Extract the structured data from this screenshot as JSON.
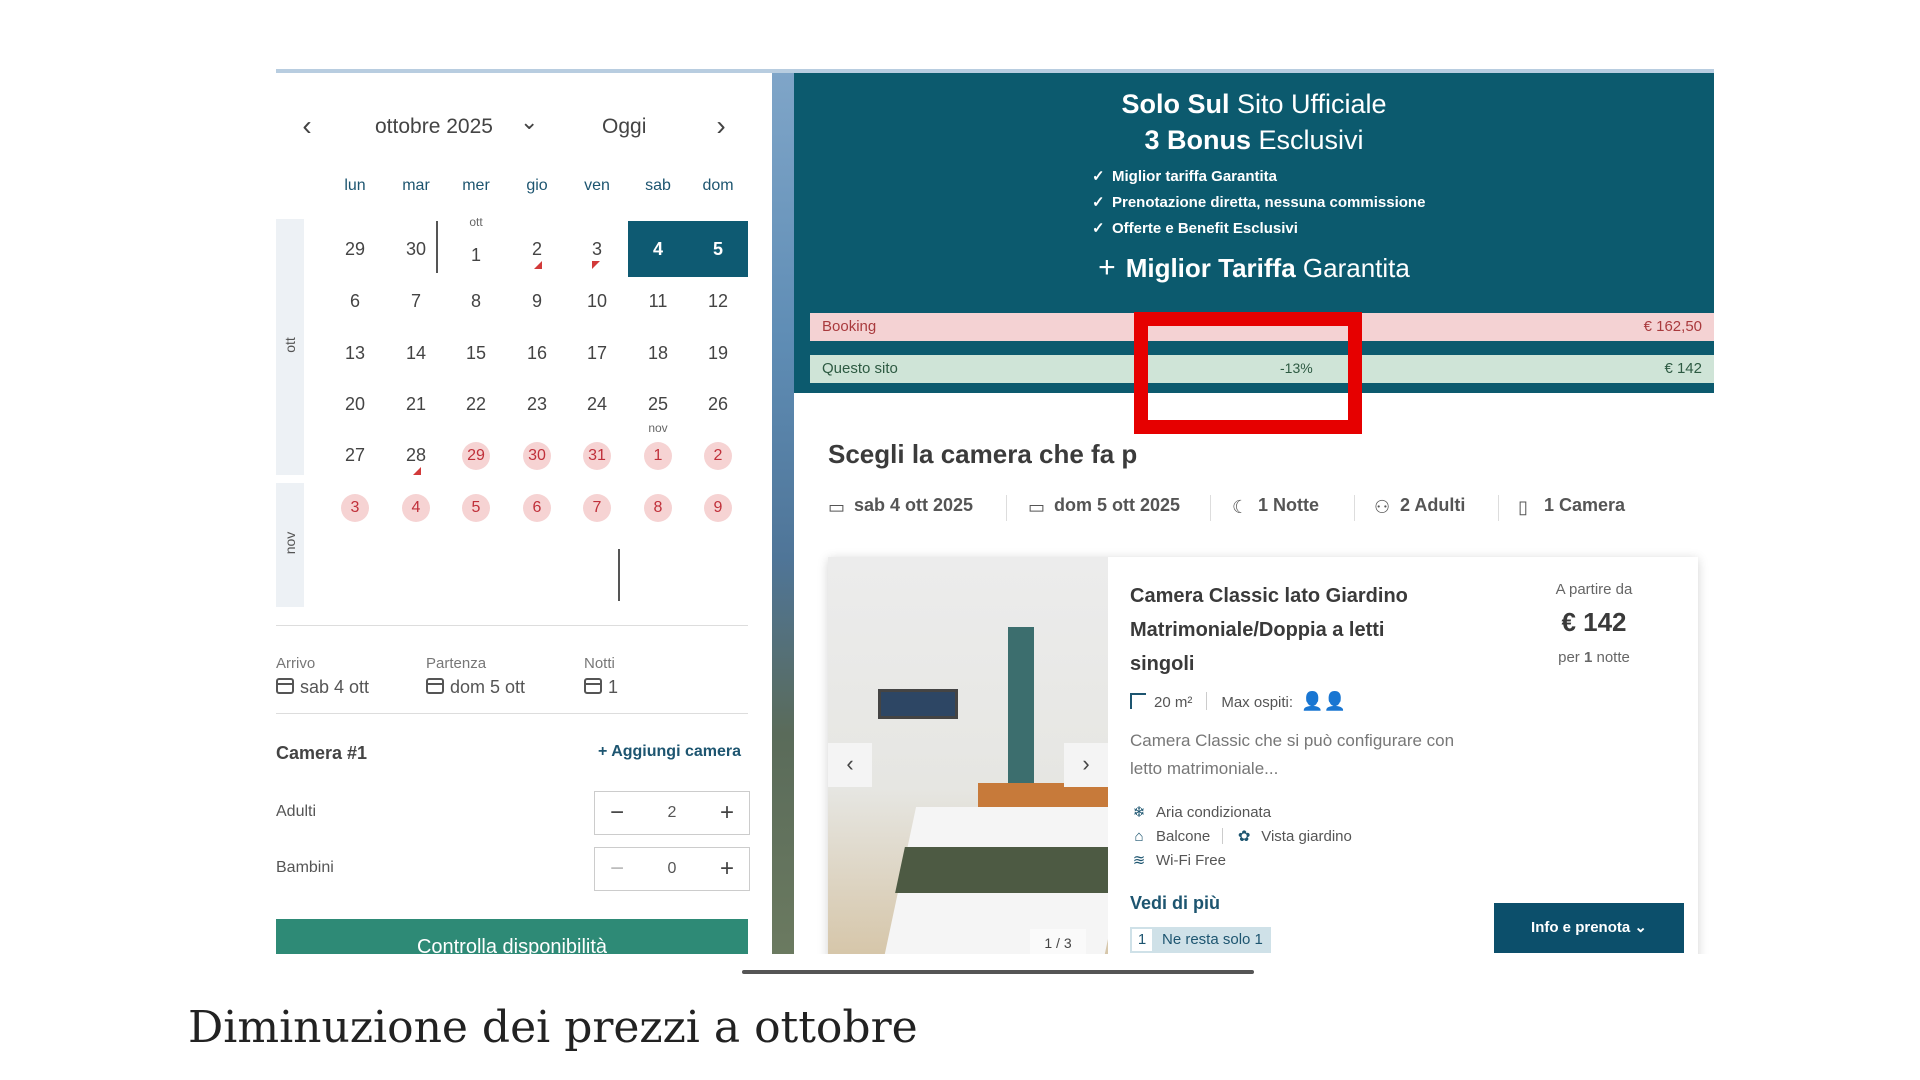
{
  "calendar": {
    "month_title": "ottobre 2025",
    "today": "Oggi",
    "weekdays": [
      "lun",
      "mar",
      "mer",
      "gio",
      "ven",
      "sab",
      "dom"
    ],
    "side_oct": "ott",
    "side_nov": "nov",
    "oct_label": "ott",
    "nov_label": "nov",
    "rows": [
      [
        "29",
        "30",
        "1",
        "2",
        "3",
        "4",
        "5"
      ],
      [
        "6",
        "7",
        "8",
        "9",
        "10",
        "11",
        "12"
      ],
      [
        "13",
        "14",
        "15",
        "16",
        "17",
        "18",
        "19"
      ],
      [
        "20",
        "21",
        "22",
        "23",
        "24",
        "25",
        "26"
      ],
      [
        "27",
        "28",
        "29",
        "30",
        "31",
        "1",
        "2"
      ],
      [
        "3",
        "4",
        "5",
        "6",
        "7",
        "8",
        "9"
      ]
    ]
  },
  "summary": {
    "arrival_label": "Arrivo",
    "arrival_value": "sab 4 ott",
    "departure_label": "Partenza",
    "departure_value": "dom 5 ott",
    "nights_label": "Notti",
    "nights_value": "1"
  },
  "rooms": {
    "title": "Camera #1",
    "add_room": "Aggiungi camera",
    "adults_label": "Adulti",
    "adults_value": "2",
    "children_label": "Bambini",
    "children_value": "0",
    "check_button": "Controlla disponibilità"
  },
  "banner": {
    "line1_bold": "Solo Sul",
    "line1_rest": "Sito Ufficiale",
    "line2_bold": "3  Bonus",
    "line2_rest": "Esclusivi",
    "checks": [
      "Miglior tariffa Garantita",
      "Prenotazione diretta, nessuna commissione",
      "Offerte e Benefit Esclusivi"
    ],
    "plus_bold": "Miglior Tariffa",
    "plus_rest": "Garantita"
  },
  "comparison": {
    "booking_label": "Booking",
    "booking_price": "€ 162,50",
    "site_label": "Questo sito",
    "site_discount": "-13%",
    "site_price": "€ 142"
  },
  "search": {
    "heading": "Scegli la camera che fa p",
    "checkin": "sab 4 ott 2025",
    "checkout": "dom 5 ott 2025",
    "nights": "1 Notte",
    "adults": "2 Adulti",
    "rooms": "1 Camera"
  },
  "room_card": {
    "title": "Camera Classic lato Giardino Matrimoniale/Doppia a letti singoli",
    "size": "20 m²",
    "max_guests_label": "Max ospiti:",
    "description": "Camera Classic che si può configurare con letto matrimoniale...",
    "amenities": [
      "Aria condizionata",
      "Balcone",
      "Vista giardino",
      "Wi-Fi Free"
    ],
    "see_more": "Vedi di più",
    "left_count": "1",
    "left_text": "Ne resta solo 1",
    "from_label": "A partire da",
    "price": "€ 142",
    "per_prefix": "per",
    "per_count": "1",
    "per_suffix": "notte",
    "photo_counter": "1 / 3",
    "book_button": "Info e prenota"
  },
  "caption": "Diminuzione dei prezzi a ottobre",
  "colors": {
    "brand_teal": "#0c5a6e",
    "selected_day": "#0e5a72",
    "check_button": "#2e8a76",
    "booking_row": "#f4d2d3",
    "site_row": "#cfe4d7",
    "highlight_box": "#e60000"
  }
}
